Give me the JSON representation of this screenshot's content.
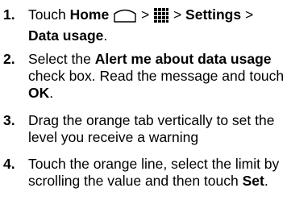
{
  "steps": [
    {
      "number": "1.",
      "touch": "Touch",
      "home": "Home",
      "home_icon": "home-icon",
      "sep1": ">",
      "apps_icon": "apps-grid-icon",
      "sep2": ">",
      "settings": "Settings",
      "sep3": ">",
      "data_usage": "Data usage",
      "end": "."
    },
    {
      "number": "2.",
      "pre": "Select the",
      "bold": "Alert me about data usage",
      "post": "check box. Read the message and touch",
      "ok": "OK",
      "end": "."
    },
    {
      "number": "3.",
      "text": "Drag the orange tab vertically to set the level you receive a warning"
    },
    {
      "number": "4.",
      "pre": "Touch the orange line, select the limit by scrolling the value and then touch",
      "set": "Set",
      "end": "."
    }
  ]
}
